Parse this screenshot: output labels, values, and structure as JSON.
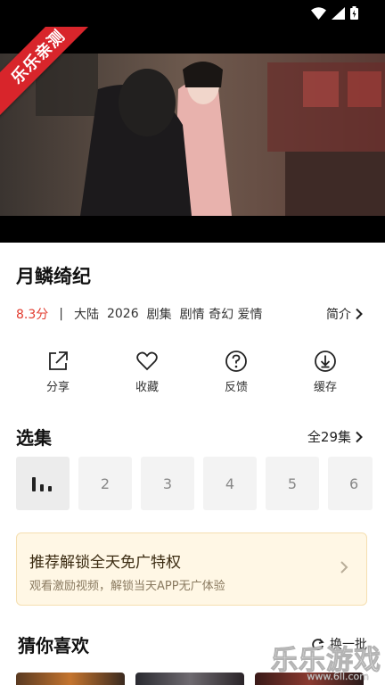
{
  "player": {
    "ribbon": "乐乐亲测"
  },
  "drama": {
    "title": "月鳞绮纪",
    "score": "8.3分",
    "separator": "|",
    "region": "大陆",
    "year": "2026",
    "category": "剧集",
    "genres": "剧情 奇幻 爱情",
    "intro_label": "简介"
  },
  "actions": [
    {
      "label": "分享",
      "icon": "share-icon"
    },
    {
      "label": "收藏",
      "icon": "heart-icon"
    },
    {
      "label": "反馈",
      "icon": "help-icon"
    },
    {
      "label": "缓存",
      "icon": "download-icon"
    }
  ],
  "episodes": {
    "title": "选集",
    "all_label": "全29集",
    "items": [
      "2",
      "3",
      "4",
      "5",
      "6"
    ]
  },
  "promo": {
    "title": "推荐解锁全天免广特权",
    "subtitle": "观看激励视频，解锁当天APP无广体验"
  },
  "recommend": {
    "title": "猜你喜欢",
    "refresh_label": "换一批"
  },
  "watermark": {
    "text": "乐乐游戏",
    "sub": "www.6ll.com"
  },
  "colors": {
    "score": "#e23b2e",
    "ribbon": "#d8252b",
    "promo_bg": "#fff7e5"
  }
}
